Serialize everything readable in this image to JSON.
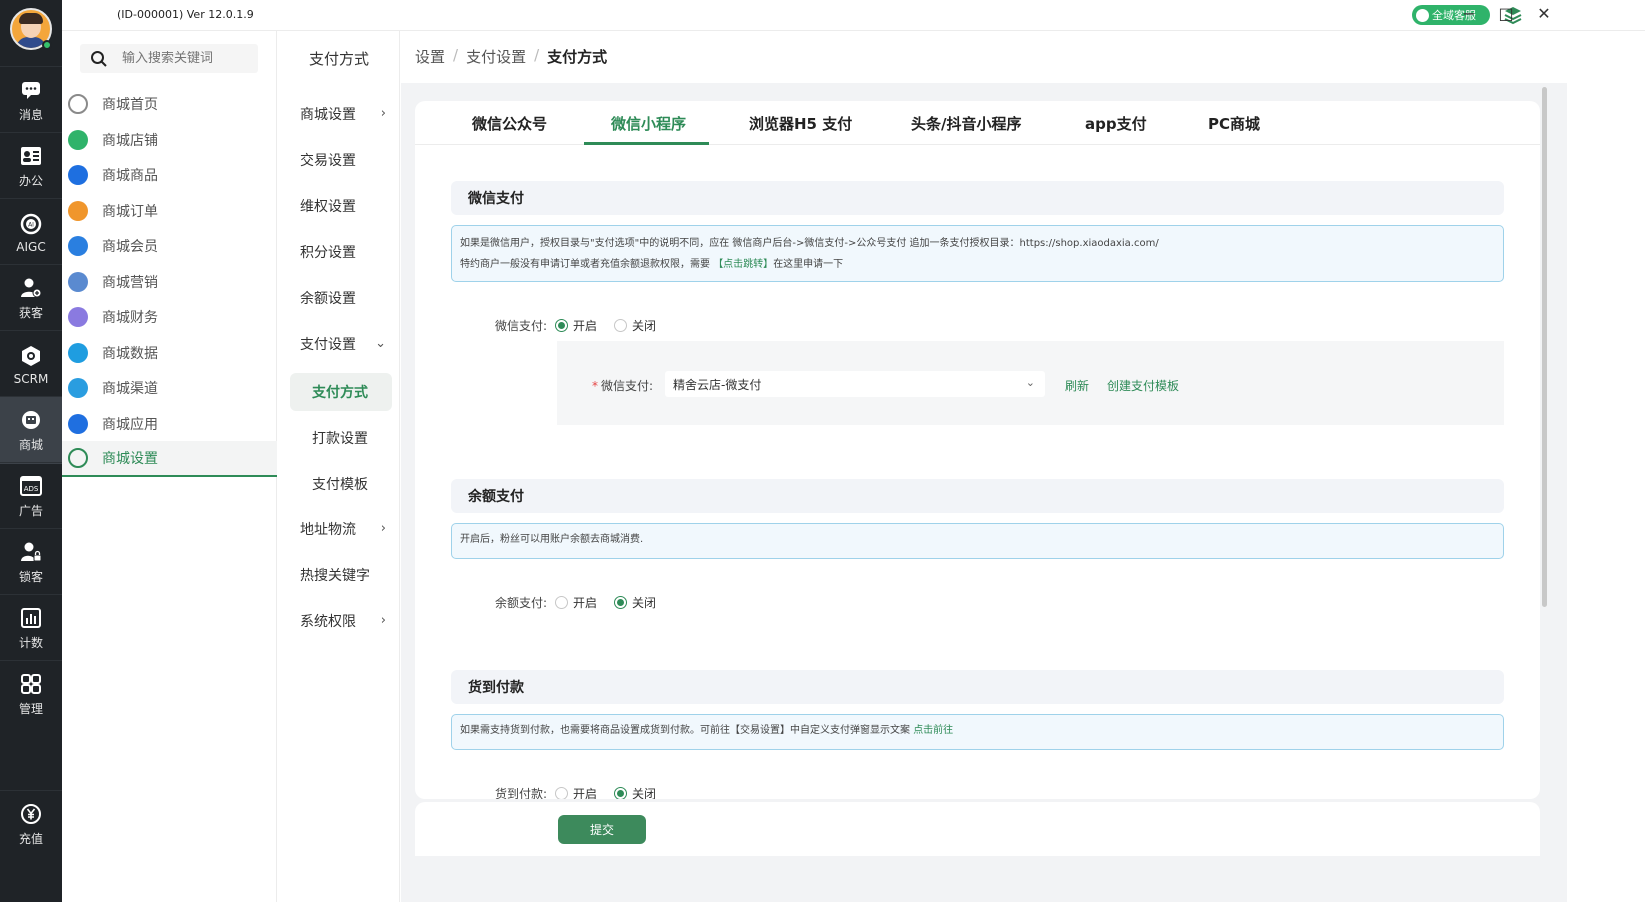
{
  "window": {
    "version": "(ID-000001)  Ver 12.0.1.9",
    "service_label": "全域客服"
  },
  "rail": {
    "items": [
      {
        "label": "消息",
        "icon": "chat-icon"
      },
      {
        "label": "办公",
        "icon": "id-card-icon"
      },
      {
        "label": "AIGC",
        "icon": "ai-icon"
      },
      {
        "label": "获客",
        "icon": "user-add-icon"
      },
      {
        "label": "SCRM",
        "icon": "scrm-icon"
      },
      {
        "label": "商城",
        "icon": "shop-icon"
      },
      {
        "label": "广告",
        "icon": "ads-icon"
      },
      {
        "label": "锁客",
        "icon": "user-lock-icon"
      },
      {
        "label": "计数",
        "icon": "bar-chart-icon"
      },
      {
        "label": "管理",
        "icon": "grid-icon"
      }
    ],
    "bottom": {
      "label": "充值",
      "icon": "yuan-icon"
    }
  },
  "search": {
    "placeholder": "输入搜索关键词"
  },
  "shop_menu": [
    {
      "label": "商城首页",
      "color": "#8a8a8a"
    },
    {
      "label": "商城店铺",
      "color": "#2fb36a"
    },
    {
      "label": "商城商品",
      "color": "#1e6fe0"
    },
    {
      "label": "商城订单",
      "color": "#f0962c"
    },
    {
      "label": "商城会员",
      "color": "#2a7fe0"
    },
    {
      "label": "商城营销",
      "color": "#5a8ad0"
    },
    {
      "label": "商城财务",
      "color": "#8a7ae0"
    },
    {
      "label": "商城数据",
      "color": "#1f9de0"
    },
    {
      "label": "商城渠道",
      "color": "#2a9de0"
    },
    {
      "label": "商城应用",
      "color": "#1f6fe0"
    },
    {
      "label": "商城设置",
      "color": "#2e8b57"
    }
  ],
  "subnav": {
    "head": "支付方式",
    "items": [
      {
        "label": "商城设置",
        "chev": "›"
      },
      {
        "label": "交易设置",
        "chev": ""
      },
      {
        "label": "维权设置",
        "chev": ""
      },
      {
        "label": "积分设置",
        "chev": ""
      },
      {
        "label": "余额设置",
        "chev": ""
      },
      {
        "label": "支付设置",
        "chev": "⌄"
      },
      {
        "label": "支付方式",
        "chev": ""
      },
      {
        "label": "打款设置",
        "chev": ""
      },
      {
        "label": "支付模板",
        "chev": ""
      },
      {
        "label": "地址物流",
        "chev": "›"
      },
      {
        "label": "热搜关键字",
        "chev": ""
      },
      {
        "label": "系统权限",
        "chev": "›"
      }
    ]
  },
  "breadcrumb": {
    "items": [
      "设置",
      "支付设置",
      "支付方式"
    ],
    "sep": "/"
  },
  "tabs": [
    "微信公众号",
    "微信小程序",
    "浏览器H5 支付",
    "头条/抖音小程序",
    "app支付",
    "PC商城"
  ],
  "wechat": {
    "title": "微信支付",
    "notice_line1": "如果是微信用户，授权目录与\"支付选项\"中的说明不同，应在 微信商户后台->微信支付->公众号支付 追加一条支付授权目录：https://shop.xiaodaxia.com/",
    "notice_line2_a": "特约商户一般没有申请订单或者充值余额退款权限，需要 ",
    "notice_line2_link": "【点击跳转】",
    "notice_line2_b": "在这里申请一下",
    "label": "微信支付:",
    "on": "开启",
    "off": "关闭",
    "sub_label": "微信支付:",
    "select_value": "精舍云店-微支付",
    "refresh": "刷新",
    "create_template": "创建支付模板"
  },
  "balance": {
    "title": "余额支付",
    "notice": "开启后，粉丝可以用账户余额去商城消费.",
    "label": "余额支付:",
    "on": "开启",
    "off": "关闭"
  },
  "cod": {
    "title": "货到付款",
    "notice_a": "如果需支持货到付款，也需要将商品设置成货到付款。可前往【交易设置】中自定义支付弹窗显示文案 ",
    "notice_link": "点击前往",
    "label": "货到付款:",
    "on": "开启",
    "off": "关闭"
  },
  "submit_label": "提交"
}
